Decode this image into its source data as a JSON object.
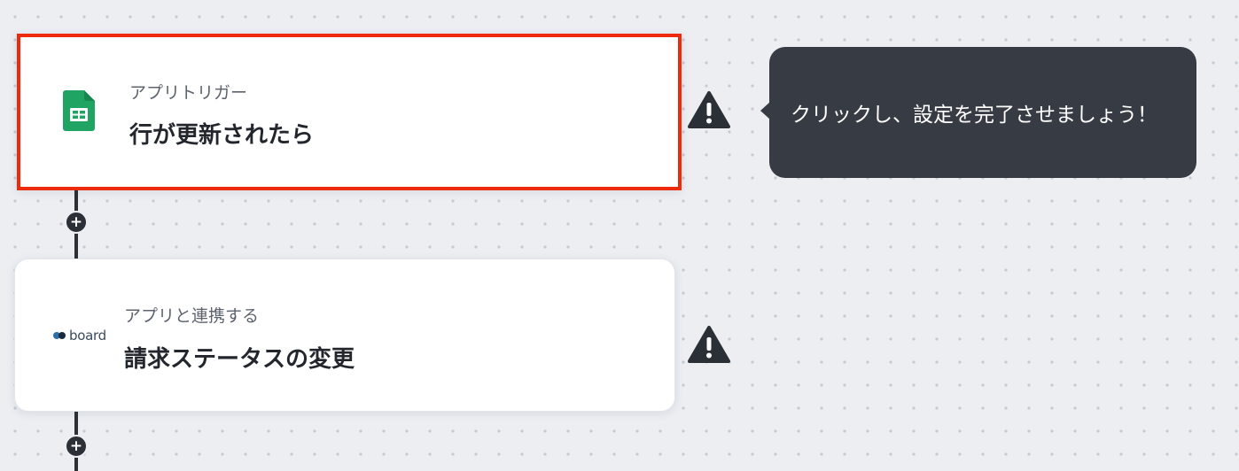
{
  "flow": {
    "steps": [
      {
        "subtitle": "アプリトリガー",
        "title": "行が更新されたら",
        "app_icon": "google-sheets-icon",
        "selected": true
      },
      {
        "subtitle": "アプリと連携する",
        "title": "請求ステータスの変更",
        "app_icon": "board-logo",
        "app_logo_text": "board",
        "selected": false
      }
    ],
    "add_step_label": "+"
  },
  "tooltip": {
    "text": "クリックし、設定を完了させましょう！"
  },
  "colors": {
    "selected_border": "#ee2a0c",
    "tooltip_bg": "#373b43",
    "connector": "#2b2f36",
    "warning": "#2b2f36",
    "sheets_green": "#1fa463"
  }
}
